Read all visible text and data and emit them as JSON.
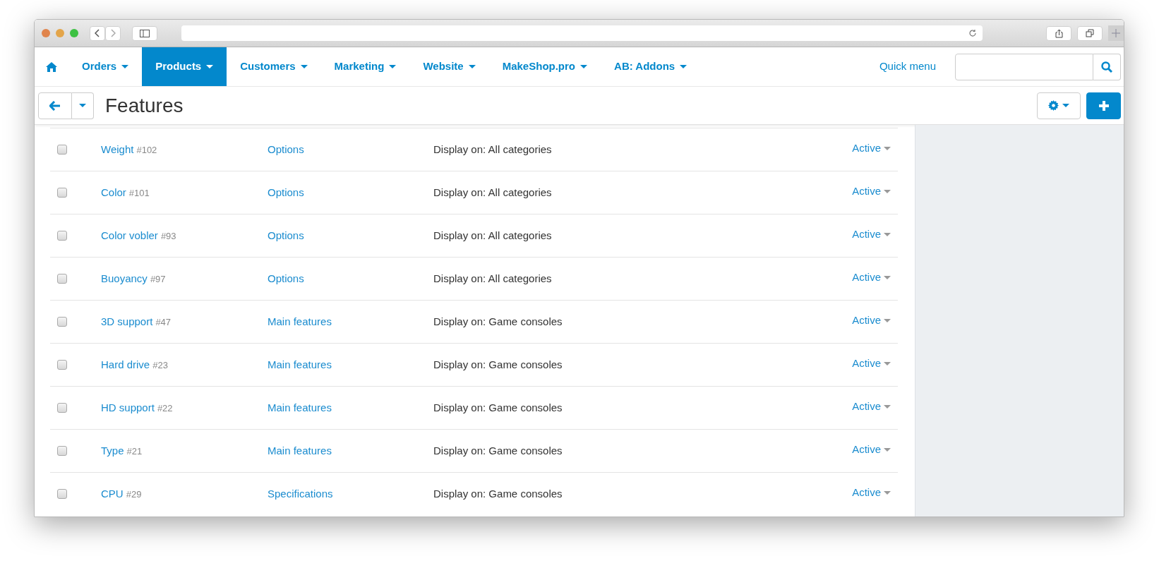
{
  "nav": {
    "items": [
      {
        "label": "Orders",
        "selected": false
      },
      {
        "label": "Products",
        "selected": true
      },
      {
        "label": "Customers",
        "selected": false
      },
      {
        "label": "Marketing",
        "selected": false
      },
      {
        "label": "Website",
        "selected": false
      },
      {
        "label": "MakeShop.pro",
        "selected": false
      },
      {
        "label": "AB: Addons",
        "selected": false
      }
    ],
    "quick_menu": "Quick menu"
  },
  "page_title": "Features",
  "rows": [
    {
      "name": "Weight",
      "id": "#102",
      "group": "Options",
      "display": "Display on: All categories",
      "status": "Active",
      "checked": false
    },
    {
      "name": "Color",
      "id": "#101",
      "group": "Options",
      "display": "Display on: All categories",
      "status": "Active",
      "checked": false
    },
    {
      "name": "Color vobler",
      "id": "#93",
      "group": "Options",
      "display": "Display on: All categories",
      "status": "Active",
      "checked": false
    },
    {
      "name": "Buoyancy",
      "id": "#97",
      "group": "Options",
      "display": "Display on: All categories",
      "status": "Active",
      "checked": false
    },
    {
      "name": "3D support",
      "id": "#47",
      "group": "Main features",
      "display": "Display on: Game consoles",
      "status": "Active",
      "checked": false
    },
    {
      "name": "Hard drive",
      "id": "#23",
      "group": "Main features",
      "display": "Display on: Game consoles",
      "status": "Active",
      "checked": false
    },
    {
      "name": "HD support",
      "id": "#22",
      "group": "Main features",
      "display": "Display on: Game consoles",
      "status": "Active",
      "checked": false
    },
    {
      "name": "Type",
      "id": "#21",
      "group": "Main features",
      "display": "Display on: Game consoles",
      "status": "Active",
      "checked": false
    },
    {
      "name": "CPU",
      "id": "#29",
      "group": "Specifications",
      "display": "Display on: Game consoles",
      "status": "Active",
      "checked": false
    }
  ]
}
